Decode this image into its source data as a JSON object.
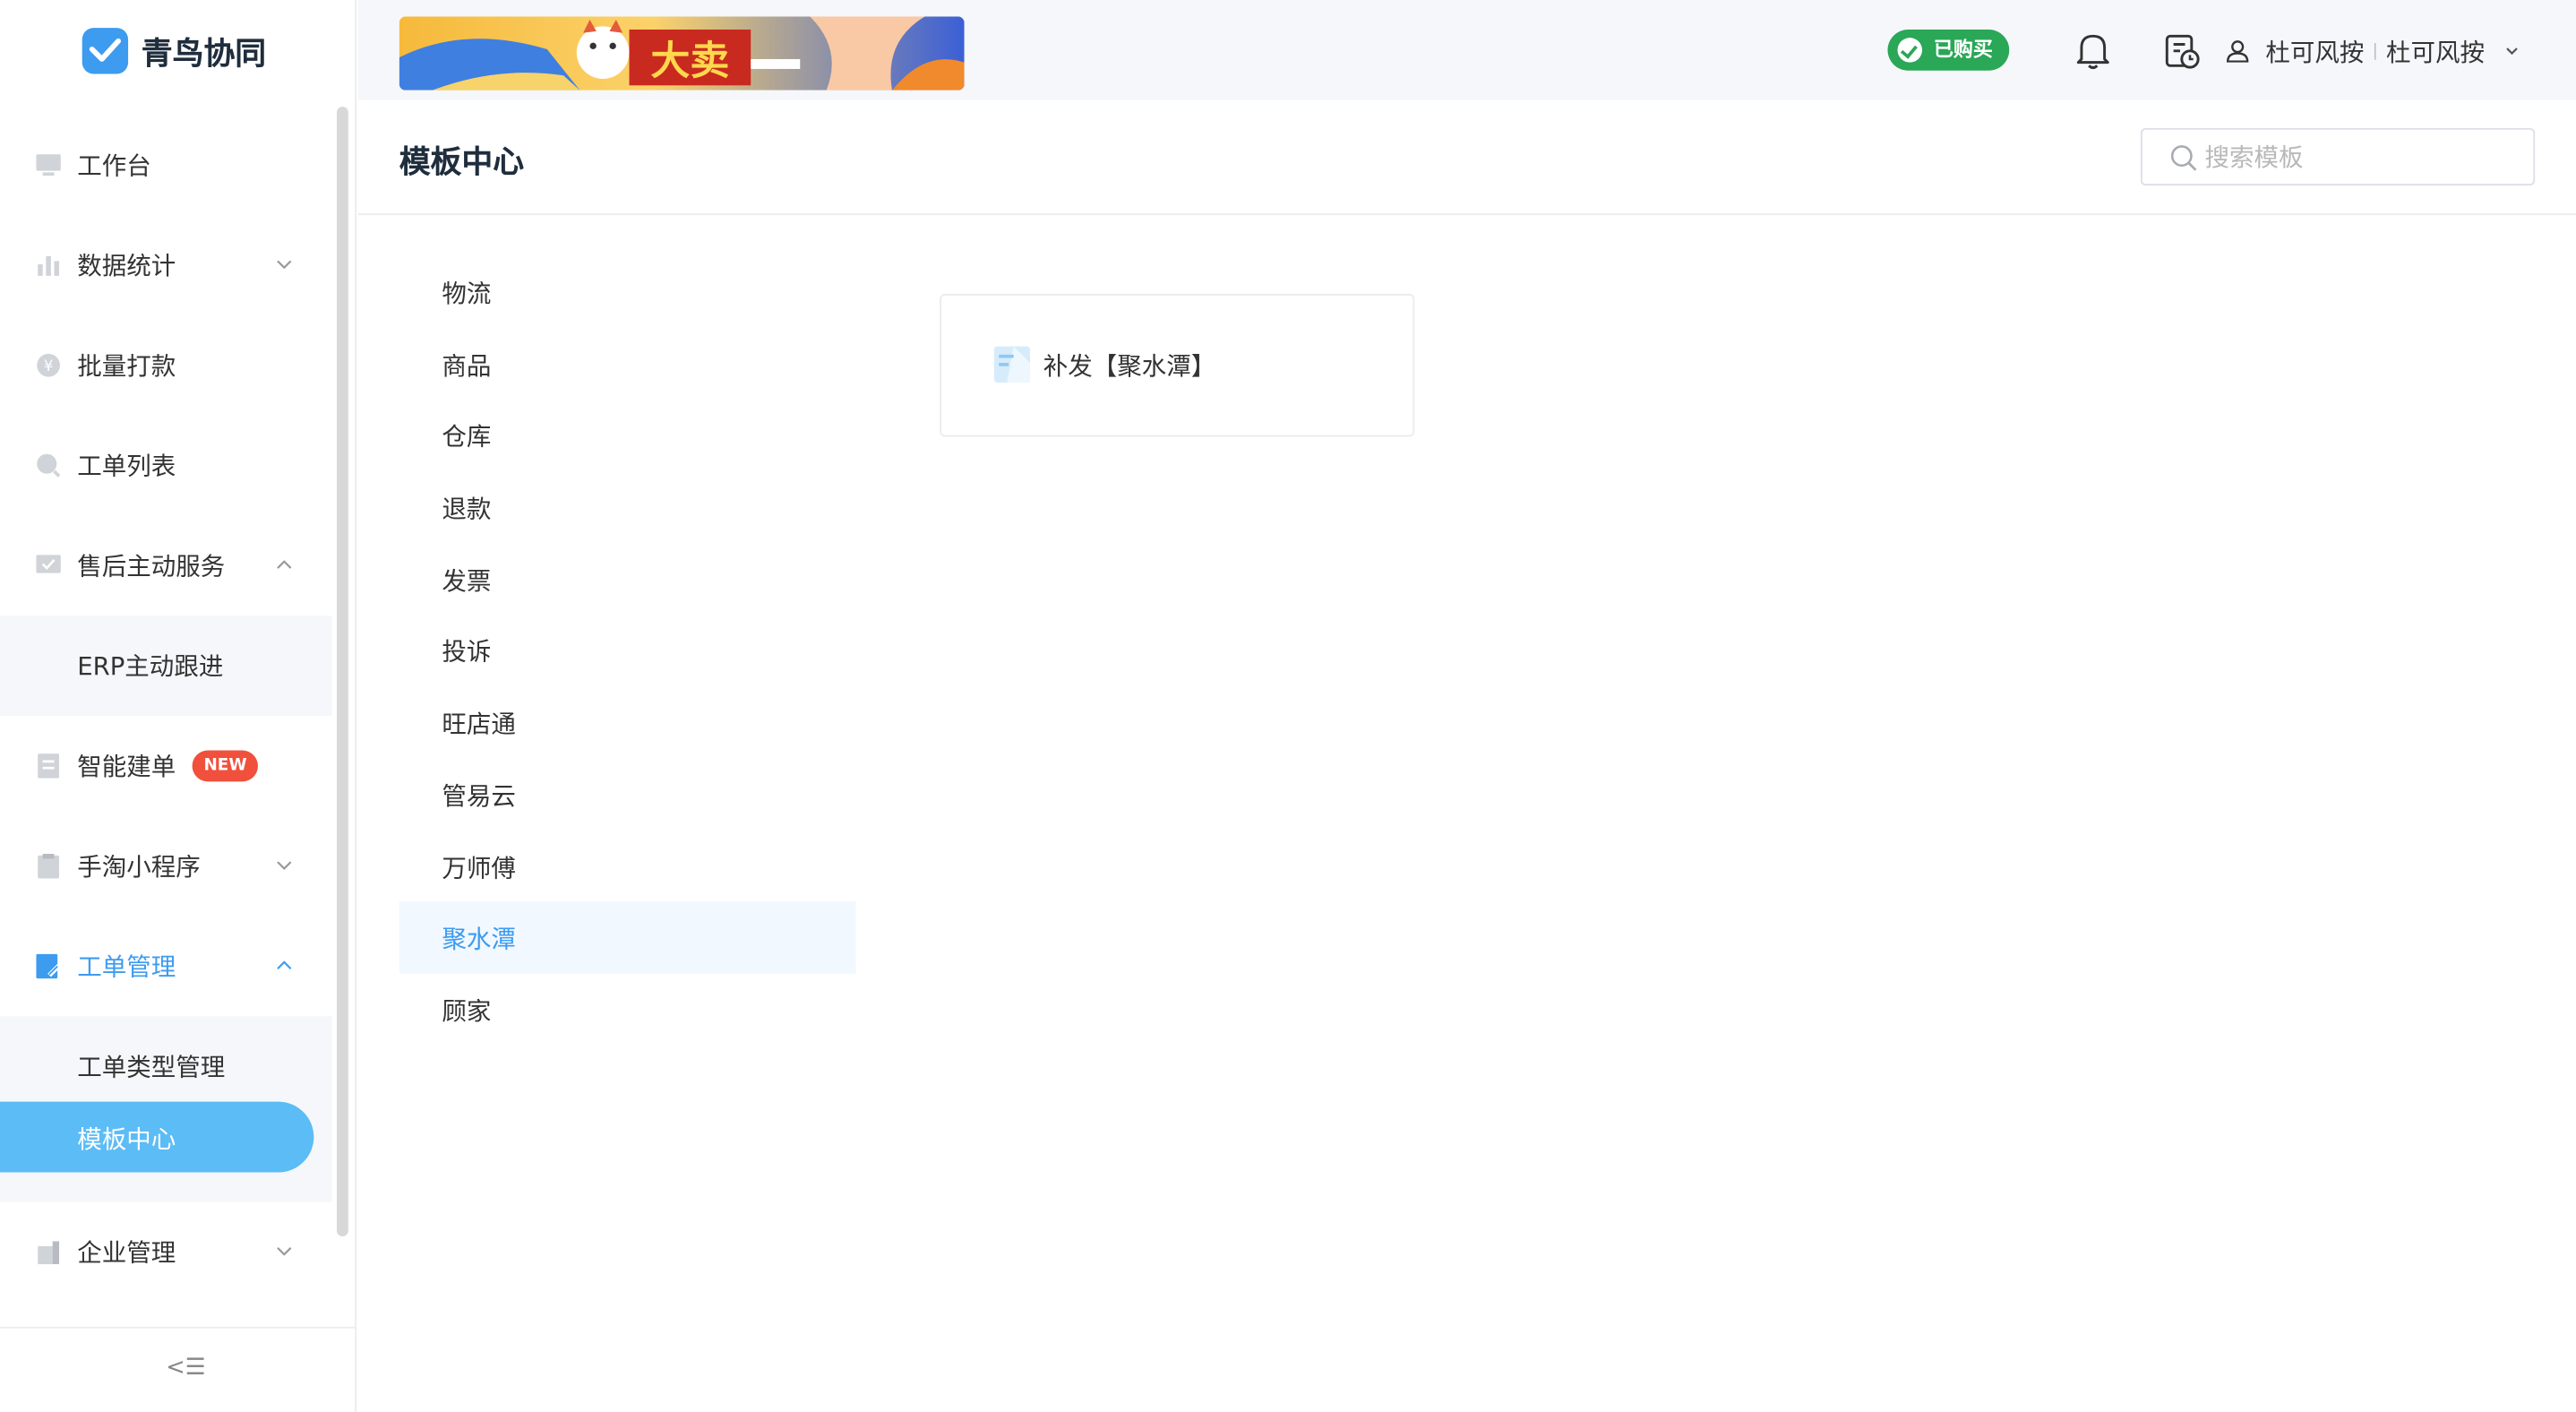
{
  "app": {
    "logo_text": "青鸟协同"
  },
  "sidebar": {
    "items": [
      {
        "label": "工作台",
        "icon": "monitor-icon"
      },
      {
        "label": "数据统计",
        "icon": "bar-chart-icon",
        "expand": "collapsed"
      },
      {
        "label": "批量打款",
        "icon": "coin-icon"
      },
      {
        "label": "工单列表",
        "icon": "search-icon"
      },
      {
        "label": "售后主动服务",
        "icon": "chat-check-icon",
        "expand": "expanded"
      },
      {
        "label": "ERP主动跟进",
        "sub": true
      },
      {
        "label": "智能建单",
        "icon": "document-icon",
        "badge": "NEW"
      },
      {
        "label": "手淘小程序",
        "icon": "clipboard-icon",
        "expand": "collapsed"
      },
      {
        "label": "工单管理",
        "icon": "edit-doc-icon",
        "expand": "expanded",
        "active": true
      },
      {
        "label": "工单类型管理",
        "sub": true
      },
      {
        "label": "模板中心",
        "sub": true,
        "selected": true
      },
      {
        "label": "企业管理",
        "icon": "building-icon",
        "expand": "collapsed"
      }
    ],
    "collapse_icon": "collapse-menu-icon",
    "collapse_glyph": "<☰"
  },
  "header": {
    "banner_glyph": "大卖",
    "purchased_badge": "已购买",
    "bell_icon": "bell-icon",
    "calendar_icon": "calendar-clock-icon",
    "user_name": "杜可风按",
    "user_org": "杜可风按",
    "user_separator": "|"
  },
  "page": {
    "title": "模板中心",
    "search_placeholder": "搜索模板"
  },
  "categories": [
    "物流",
    "商品",
    "仓库",
    "退款",
    "发票",
    "投诉",
    "旺店通",
    "管易云",
    "万师傅",
    "聚水潭",
    "顾家"
  ],
  "selected_category": "聚水潭",
  "templates": [
    {
      "label": "补发【聚水潭】",
      "icon": "template-doc-icon"
    }
  ],
  "colors": {
    "accent": "#3d9bf0",
    "selected_pill": "#5cbcf6",
    "badge_red": "#f0503c",
    "badge_green": "#2aa757"
  }
}
